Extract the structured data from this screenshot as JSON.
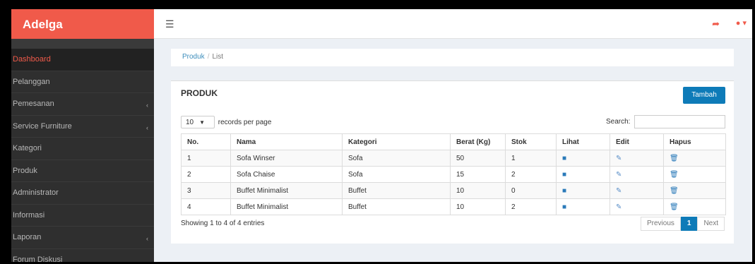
{
  "app": {
    "title": "Adelga"
  },
  "topbar": {
    "menu_icon": "hamburger-icon",
    "share_icon": "share-icon",
    "user_icon": "user-icon"
  },
  "sidebar": {
    "items": [
      {
        "label": "Dashboard",
        "active": true
      },
      {
        "label": "Pelanggan"
      },
      {
        "label": "Pemesanan",
        "caret": "‹"
      },
      {
        "label": "Service Furniture",
        "caret": "‹"
      },
      {
        "label": "Kategori"
      },
      {
        "label": "Produk"
      },
      {
        "label": "Administrator"
      },
      {
        "label": "Informasi"
      },
      {
        "label": "Laporan",
        "caret": "‹"
      },
      {
        "label": "Forum Diskusi"
      }
    ]
  },
  "breadcrumb": {
    "link": "Produk",
    "separator": "/",
    "current": "List"
  },
  "panel": {
    "title": "PRODUK",
    "add_button": "Tambah",
    "length_value": "10",
    "length_suffix": "records per page",
    "search_label": "Search:",
    "search_value": "",
    "columns": [
      "No.",
      "Nama",
      "Kategori",
      "Berat (Kg)",
      "Stok",
      "Lihat",
      "Edit",
      "Hapus"
    ],
    "rows": [
      {
        "no": "1",
        "nama": "Sofa Winser",
        "kategori": "Sofa",
        "berat": "50",
        "stok": "1"
      },
      {
        "no": "2",
        "nama": "Sofa Chaise",
        "kategori": "Sofa",
        "berat": "15",
        "stok": "2"
      },
      {
        "no": "3",
        "nama": "Buffet Minimalist",
        "kategori": "Buffet",
        "berat": "10",
        "stok": "0"
      },
      {
        "no": "4",
        "nama": "Buffet Minimalist",
        "kategori": "Buffet",
        "berat": "10",
        "stok": "2"
      }
    ],
    "info": "Showing 1 to 4 of 4 entries",
    "pager": {
      "previous": "Previous",
      "page": "1",
      "next": "Next"
    }
  }
}
